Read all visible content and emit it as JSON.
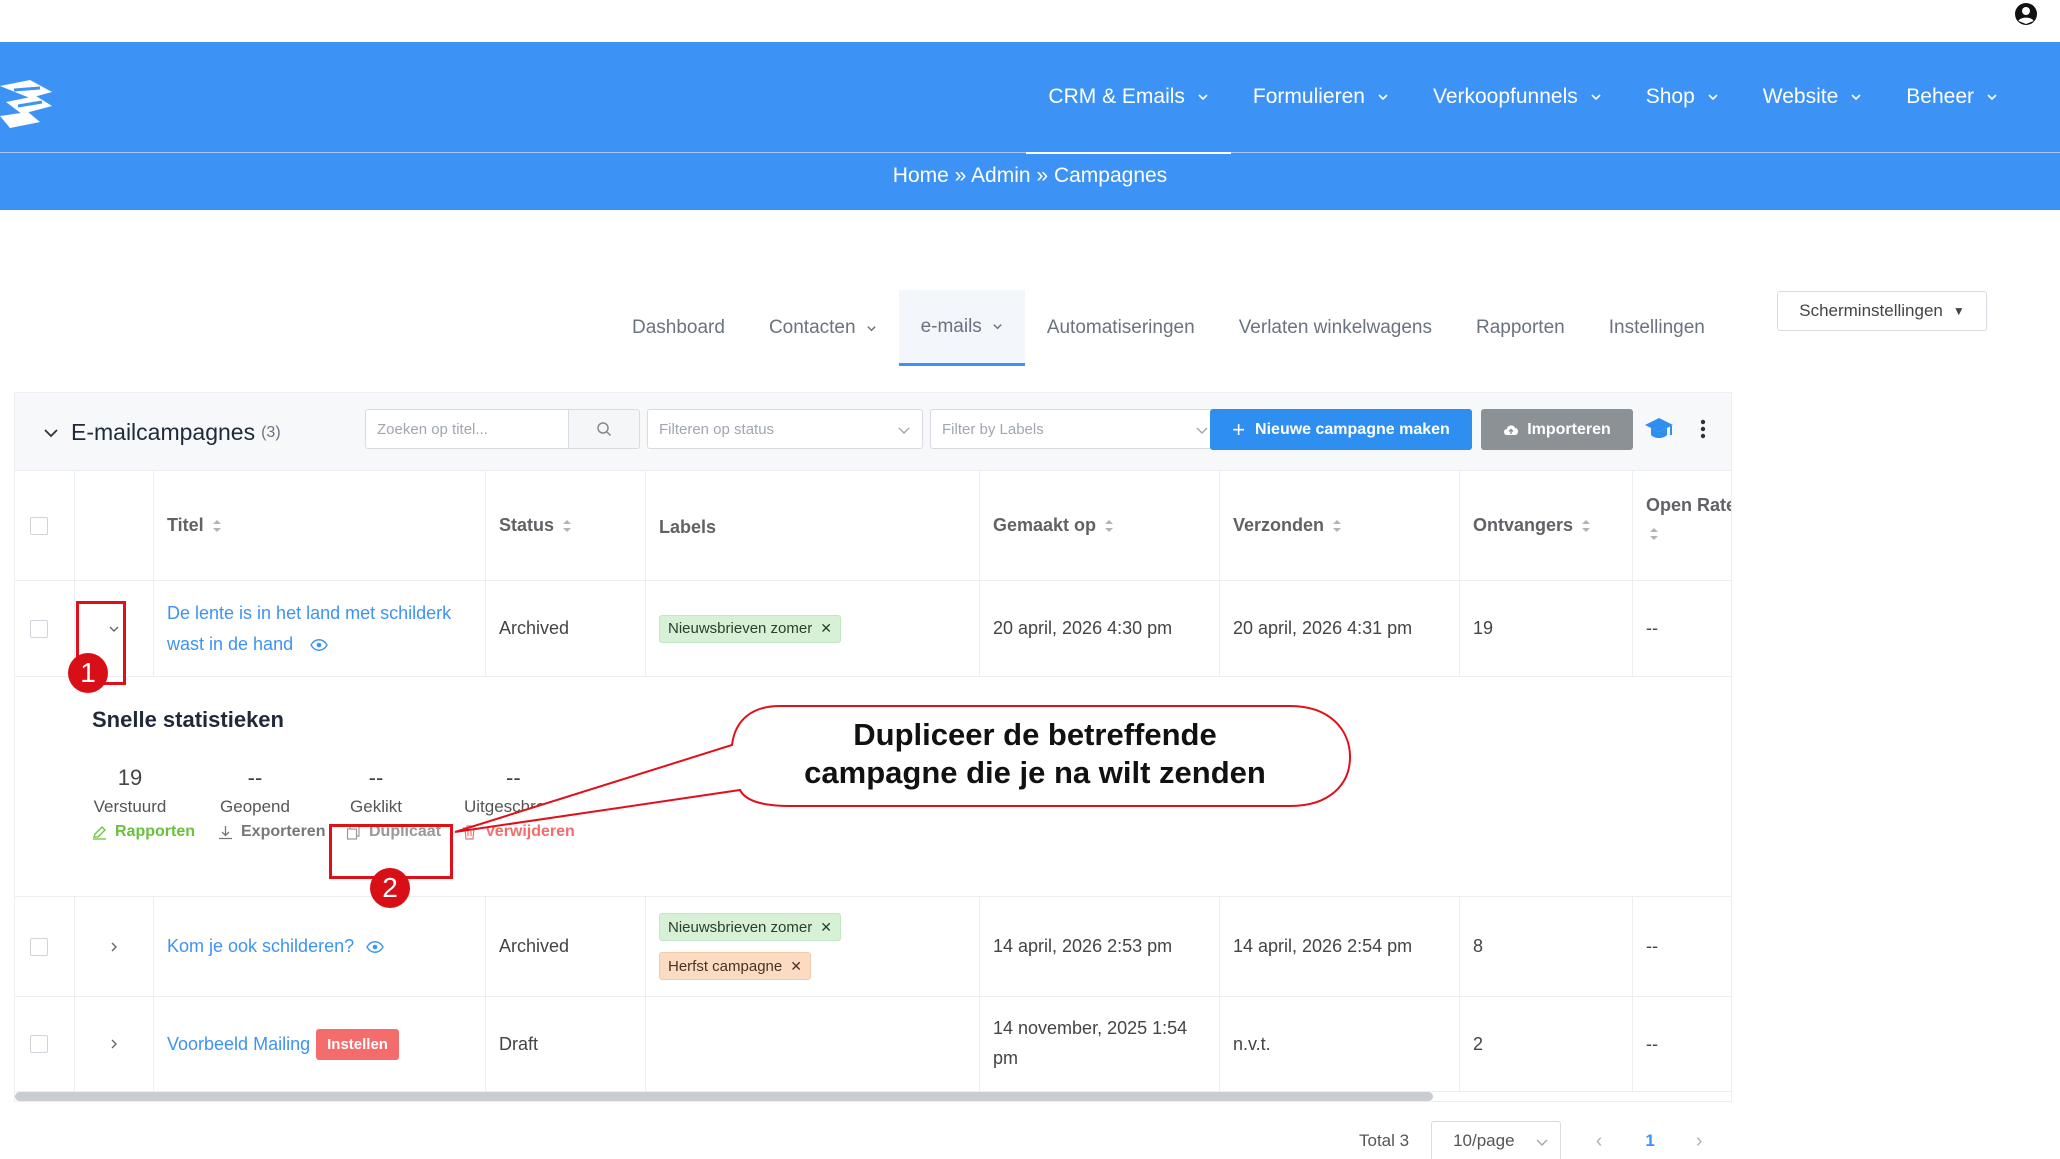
{
  "header": {
    "nav": [
      {
        "label": "CRM & Emails",
        "active": true
      },
      {
        "label": "Formulieren"
      },
      {
        "label": "Verkoopfunnels"
      },
      {
        "label": "Shop"
      },
      {
        "label": "Website"
      },
      {
        "label": "Beheer"
      }
    ],
    "breadcrumb": [
      "Home",
      "»",
      "Admin",
      "»",
      "Campagnes"
    ]
  },
  "subtabs": [
    {
      "label": "Dashboard"
    },
    {
      "label": "Contacten",
      "dropdown": true
    },
    {
      "label": "e-mails",
      "dropdown": true,
      "active": true
    },
    {
      "label": "Automatiseringen"
    },
    {
      "label": "Verlaten winkelwagens"
    },
    {
      "label": "Rapporten"
    },
    {
      "label": "Instellingen"
    }
  ],
  "screen_settings": {
    "label": "Scherminstellingen"
  },
  "card": {
    "title": "E-mailcampagnes",
    "count": "(3)",
    "search_placeholder": "Zoeken op titel...",
    "status_filter_placeholder": "Filteren op status",
    "label_filter_placeholder": "Filter by Labels",
    "new_button": "Nieuwe campagne maken",
    "import_button": "Importeren"
  },
  "table": {
    "headers": {
      "title": "Titel",
      "status": "Status",
      "labels": "Labels",
      "created": "Gemaakt op",
      "sent": "Verzonden",
      "recipients": "Ontvangers",
      "open_rate": "Open Rate"
    },
    "rows": [
      {
        "title_line1": "De lente is in het land met schilderk",
        "title_line2": "wast in de hand",
        "status": "Archived",
        "labels": [
          "Nieuwsbrieven zomer"
        ],
        "created": "20 april, 2026 4:30 pm",
        "sent": "20 april, 2026 4:31 pm",
        "recipients": "19",
        "open_rate": "--"
      },
      {
        "title": "Kom je ook schilderen?",
        "status": "Archived",
        "labels": [
          "Nieuwsbrieven zomer",
          "Herfst campagne"
        ],
        "created": "14 april, 2026 2:53 pm",
        "sent": "14 april, 2026 2:54 pm",
        "recipients": "8",
        "open_rate": "--"
      },
      {
        "title": "Voorbeeld Mailing",
        "badge": "Instellen",
        "status": "Draft",
        "created_line1": "14 november, 2025 1:54",
        "created_line2": "pm",
        "sent": "n.v.t.",
        "recipients": "2",
        "open_rate": "--"
      }
    ]
  },
  "quick_stats": {
    "title": "Snelle statistieken",
    "stats": [
      {
        "value": "19",
        "label": "Verstuurd"
      },
      {
        "value": "--",
        "label": "Geopend"
      },
      {
        "value": "--",
        "label": "Geklikt"
      },
      {
        "value": "--",
        "label": "Uitgeschre"
      }
    ],
    "actions": {
      "reports": "Rapporten",
      "export": "Exporteren",
      "duplicate": "Duplicaat",
      "delete": "Verwijderen"
    }
  },
  "pagination": {
    "total": "Total 3",
    "page_size": "10/page",
    "current_page": "1"
  },
  "annotations": {
    "callout_line1": "Dupliceer de betreffende",
    "callout_line2": "campagne die je na wilt zenden",
    "badge1": "1",
    "badge2": "2"
  },
  "colors": {
    "brand_blue": "#3d93f5",
    "annotation_red": "#d90f18",
    "success_green": "#67c23a",
    "danger_red": "#f56c6c"
  }
}
